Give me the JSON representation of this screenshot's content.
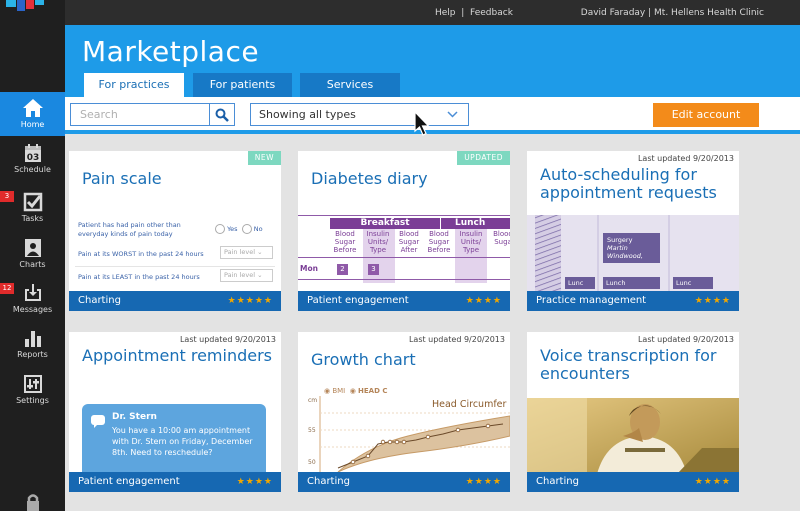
{
  "topbar": {
    "help": "Help",
    "feedback": "Feedback",
    "user": "David Faraday",
    "clinic": "Mt. Hellens Health Clinic"
  },
  "sidebar": {
    "items": [
      {
        "label": "Home",
        "icon": "home-icon",
        "active": true
      },
      {
        "label": "Schedule",
        "icon": "calendar-icon",
        "num": "03"
      },
      {
        "label": "Tasks",
        "icon": "checkbox-icon",
        "badge": "3"
      },
      {
        "label": "Charts",
        "icon": "chart-person-icon"
      },
      {
        "label": "Messages",
        "icon": "inbox-icon",
        "badge": "12"
      },
      {
        "label": "Reports",
        "icon": "bar-chart-icon"
      },
      {
        "label": "Settings",
        "icon": "sliders-icon"
      }
    ]
  },
  "header": {
    "title": "Marketplace",
    "tabs": [
      "For practices",
      "For patients",
      "Services"
    ],
    "active_tab": 0
  },
  "toolbar": {
    "search_placeholder": "Search",
    "type_select": "Showing all types",
    "edit_button": "Edit account"
  },
  "cards": [
    {
      "title": "Pain scale",
      "ribbon": "NEW",
      "category": "Charting",
      "stars": "★★★★★",
      "preview": {
        "q1": "Patient has had pain other than everyday kinds of pain today",
        "yes": "Yes",
        "no": "No",
        "q2": "Pain at its WORST in the past 24 hours",
        "q3": "Pain at its LEAST in the past 24 hours",
        "level": "Pain level"
      }
    },
    {
      "title": "Diabetes diary",
      "ribbon": "UPDATED",
      "category": "Patient engagement",
      "stars": "★★★★",
      "preview": {
        "breakfast": "Breakfast",
        "lunch": "Lunch",
        "cols": [
          "Blood Sugar Before",
          "Insulin Units/ Type",
          "Blood Sugar After",
          "Blood Sugar Before",
          "Insulin Units/ Type",
          "Blood Suga"
        ],
        "row": "Mon",
        "v1": "2",
        "v2": "3"
      }
    },
    {
      "title": "Auto-scheduling for appointment requests",
      "updated": "Last updated 9/20/2013",
      "category": "Practice management",
      "stars": "★★★★",
      "preview": {
        "appt_type": "Surgery",
        "appt_name": "Martin Windwood,",
        "lunch": [
          "Lunc",
          "Lunch",
          "Lunc"
        ]
      }
    },
    {
      "title": "Appointment reminders",
      "updated": "Last updated 9/20/2013",
      "category": "Patient engagement",
      "stars": "★★★★",
      "preview": {
        "from": "Dr. Stern",
        "message": "You have a 10:00 am appointment with Dr. Stern on Friday, December 8th. Need to reschedule?"
      }
    },
    {
      "title": "Growth chart",
      "updated": "Last updated 9/20/2013",
      "category": "Charting",
      "stars": "★★★★",
      "preview": {
        "legend1": "BMI",
        "legend2": "HEAD C",
        "unit": "cm",
        "series_label": "Head Circumfer",
        "ticks": [
          "55",
          "50"
        ]
      }
    },
    {
      "title": "Voice transcription for encounters",
      "updated": "Last updated 9/20/2013",
      "category": "Charting",
      "stars": "★★★★"
    }
  ]
}
